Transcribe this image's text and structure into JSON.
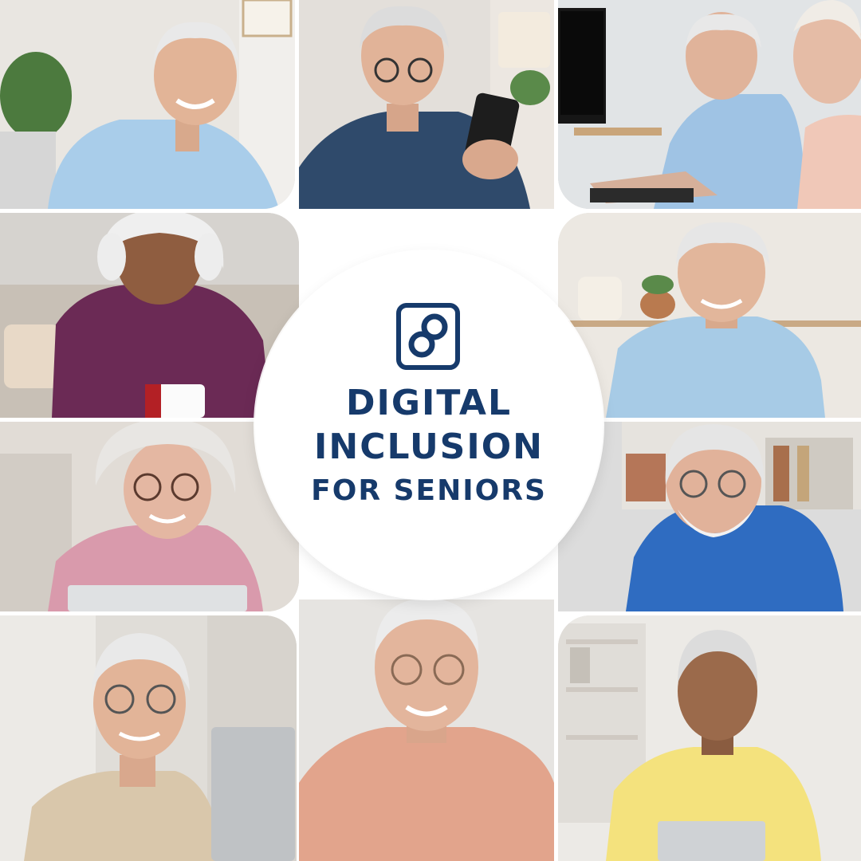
{
  "title": {
    "line1": "DIGITAL",
    "line2": "INCLUSION",
    "line3": "FOR SENIORS"
  },
  "colors": {
    "title": "#163a6b",
    "logo": "#163a6b",
    "background": "#ffffff"
  },
  "logo_icon": "linked-rings-logo-icon",
  "photos": [
    {
      "subject": "smiling older man in light blue shirt at laptop"
    },
    {
      "subject": "older man with glasses holding smartphone"
    },
    {
      "subject": "older man typing on computer keyboard"
    },
    {
      "subject": "older woman with white hair holding mug"
    },
    {
      "subject": "older man in light blue shirt"
    },
    {
      "subject": "older woman with glasses in pink top at laptop"
    },
    {
      "subject": "older man with white beard in blue polo"
    },
    {
      "subject": "older man with glasses in beige sweater at laptop"
    },
    {
      "subject": "older man in salmon shirt smiling"
    },
    {
      "subject": "older man in yellow polo writing at laptop"
    }
  ]
}
